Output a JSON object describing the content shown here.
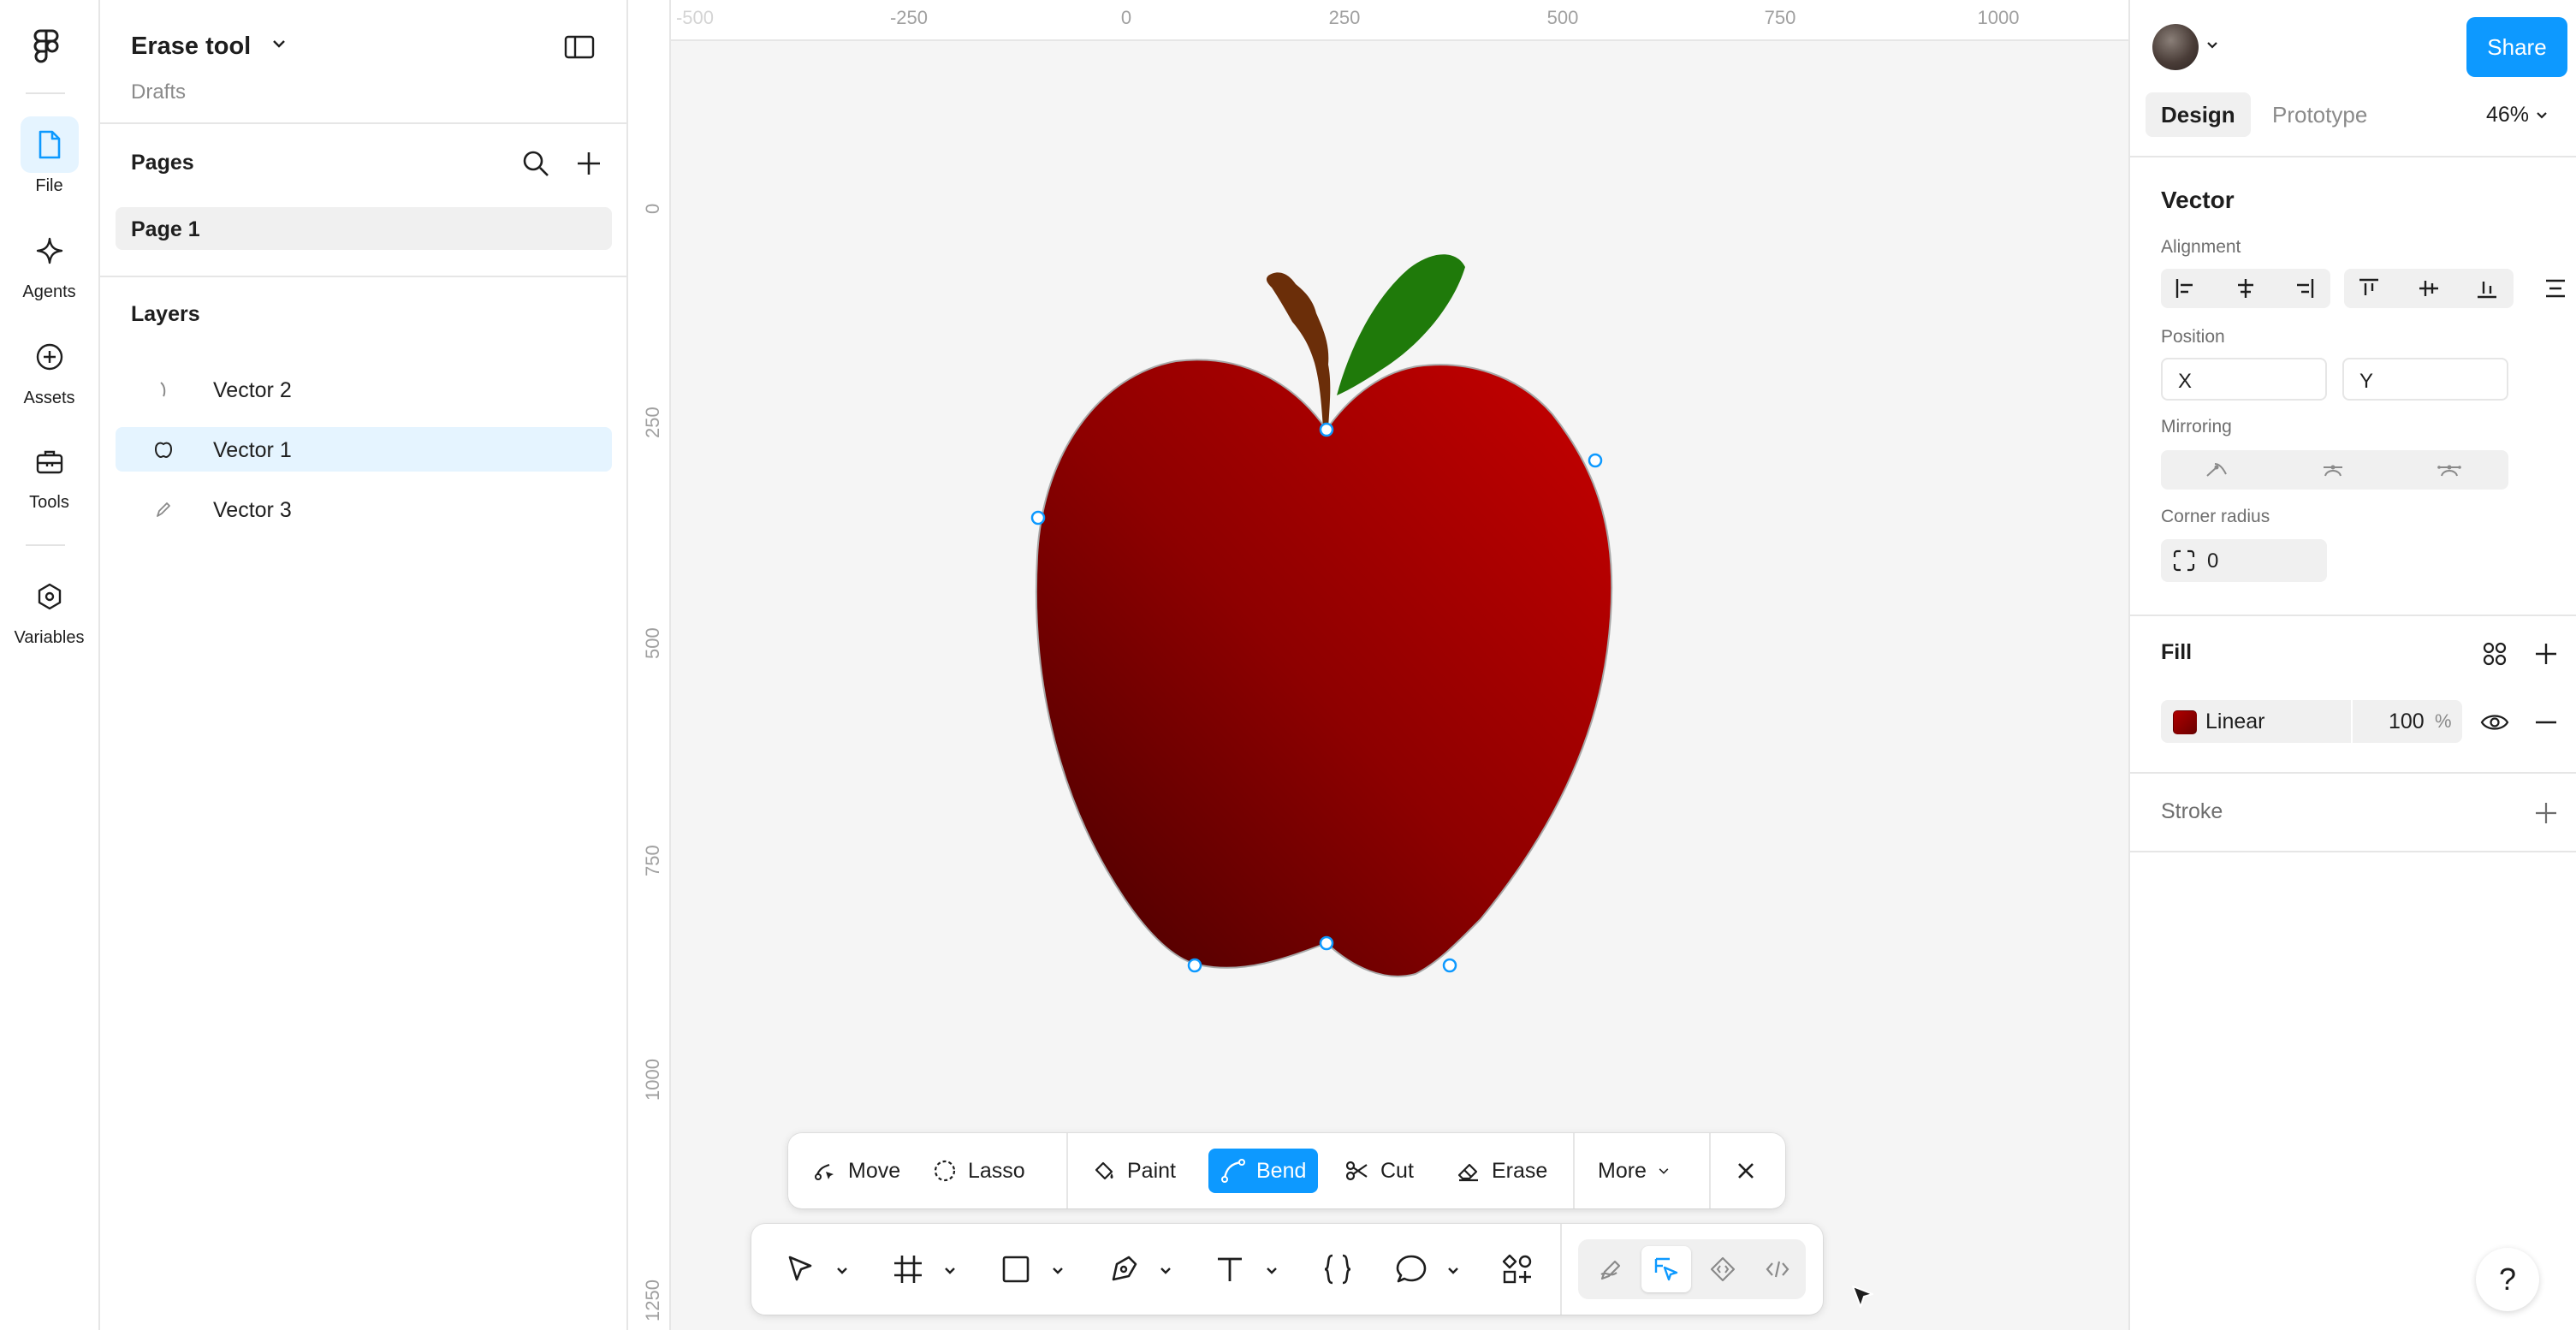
{
  "rail": {
    "items": [
      {
        "label": "File",
        "icon": "file-icon"
      },
      {
        "label": "Agents",
        "icon": "sparkle-icon"
      },
      {
        "label": "Assets",
        "icon": "plus-circle-icon"
      },
      {
        "label": "Tools",
        "icon": "toolbox-icon"
      },
      {
        "label": "Variables",
        "icon": "hexagon-icon"
      }
    ]
  },
  "file": {
    "title": "Erase tool",
    "location": "Drafts"
  },
  "pages": {
    "title": "Pages",
    "items": [
      "Page 1"
    ]
  },
  "layers": {
    "title": "Layers",
    "items": [
      {
        "name": "Vector 2",
        "selected": false
      },
      {
        "name": "Vector 1",
        "selected": true
      },
      {
        "name": "Vector 3",
        "selected": false
      }
    ]
  },
  "ruler": {
    "top": [
      "-500",
      "-250",
      "0",
      "250",
      "500",
      "750",
      "1000"
    ],
    "left": [
      "0",
      "250",
      "500",
      "750",
      "1000",
      "1250"
    ]
  },
  "edit_toolbar": {
    "move": "Move",
    "lasso": "Lasso",
    "paint": "Paint",
    "bend": "Bend",
    "cut": "Cut",
    "erase": "Erase",
    "more": "More",
    "active": "Bend"
  },
  "main_toolbar": {
    "tools": [
      "move-tool",
      "frame-tool",
      "rectangle-tool",
      "pen-tool",
      "text-tool",
      "code-brackets-tool",
      "comment-tool",
      "actions-tool"
    ],
    "modes": [
      "draw-mode",
      "design-mode",
      "dev-component-mode",
      "code-mode"
    ],
    "active_mode": "design-mode"
  },
  "right_panel": {
    "share": "Share",
    "tabs": {
      "design": "Design",
      "prototype": "Prototype"
    },
    "zoom": "46%",
    "section_title": "Vector",
    "alignment_label": "Alignment",
    "position_label": "Position",
    "x_placeholder": "X",
    "y_placeholder": "Y",
    "mirroring_label": "Mirroring",
    "corner_radius_label": "Corner radius",
    "corner_radius_value": "0",
    "fill": {
      "title": "Fill",
      "type": "Linear",
      "opacity": "100",
      "unit": "%",
      "color_from": "#b00000",
      "color_to": "#5e0000"
    },
    "stroke_title": "Stroke",
    "help": "?"
  },
  "colors": {
    "accent": "#0d99ff",
    "selection_bg": "#e5f4ff",
    "apple_light": "#b80000",
    "apple_dark": "#560000",
    "leaf": "#1f7a0a",
    "stem": "#6b2e09"
  }
}
